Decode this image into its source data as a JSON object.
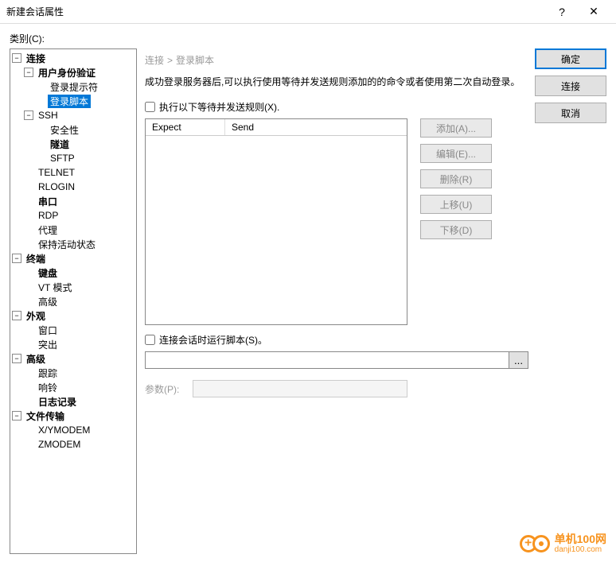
{
  "window": {
    "title": "新建会话属性"
  },
  "category_label": "类别(C):",
  "tree": {
    "n0": "连接",
    "n1": "用户身份验证",
    "n2": "登录提示符",
    "n3": "登录脚本",
    "n4": "SSH",
    "n5": "安全性",
    "n6": "隧道",
    "n7": "SFTP",
    "n8": "TELNET",
    "n9": "RLOGIN",
    "n10": "串口",
    "n11": "RDP",
    "n12": "代理",
    "n13": "保持活动状态",
    "n14": "终端",
    "n15": "键盘",
    "n16": "VT 模式",
    "n17": "高级",
    "n18": "外观",
    "n19": "窗口",
    "n20": "突出",
    "n21": "高级",
    "n22": "跟踪",
    "n23": "响铃",
    "n24": "日志记录",
    "n25": "文件传输",
    "n26": "X/YMODEM",
    "n27": "ZMODEM"
  },
  "breadcrumb": {
    "a": "连接",
    "b": "登录脚本"
  },
  "description": "成功登录服务器后,可以执行使用等待并发送规则添加的的命令或者使用第二次自动登录。",
  "checkbox1": "执行以下等待并发送规则(X).",
  "grid": {
    "col1": "Expect",
    "col2": "Send"
  },
  "buttons": {
    "add": "添加(A)...",
    "edit": "编辑(E)...",
    "del": "删除(R)",
    "up": "上移(U)",
    "down": "下移(D)",
    "ok": "确定",
    "connect": "连接",
    "cancel": "取消",
    "browse": "..."
  },
  "checkbox2": "连接会话时运行脚本(S)。",
  "param_label": "参数(P):",
  "watermark": {
    "t1": "单机100网",
    "t2": "danji100.com"
  }
}
